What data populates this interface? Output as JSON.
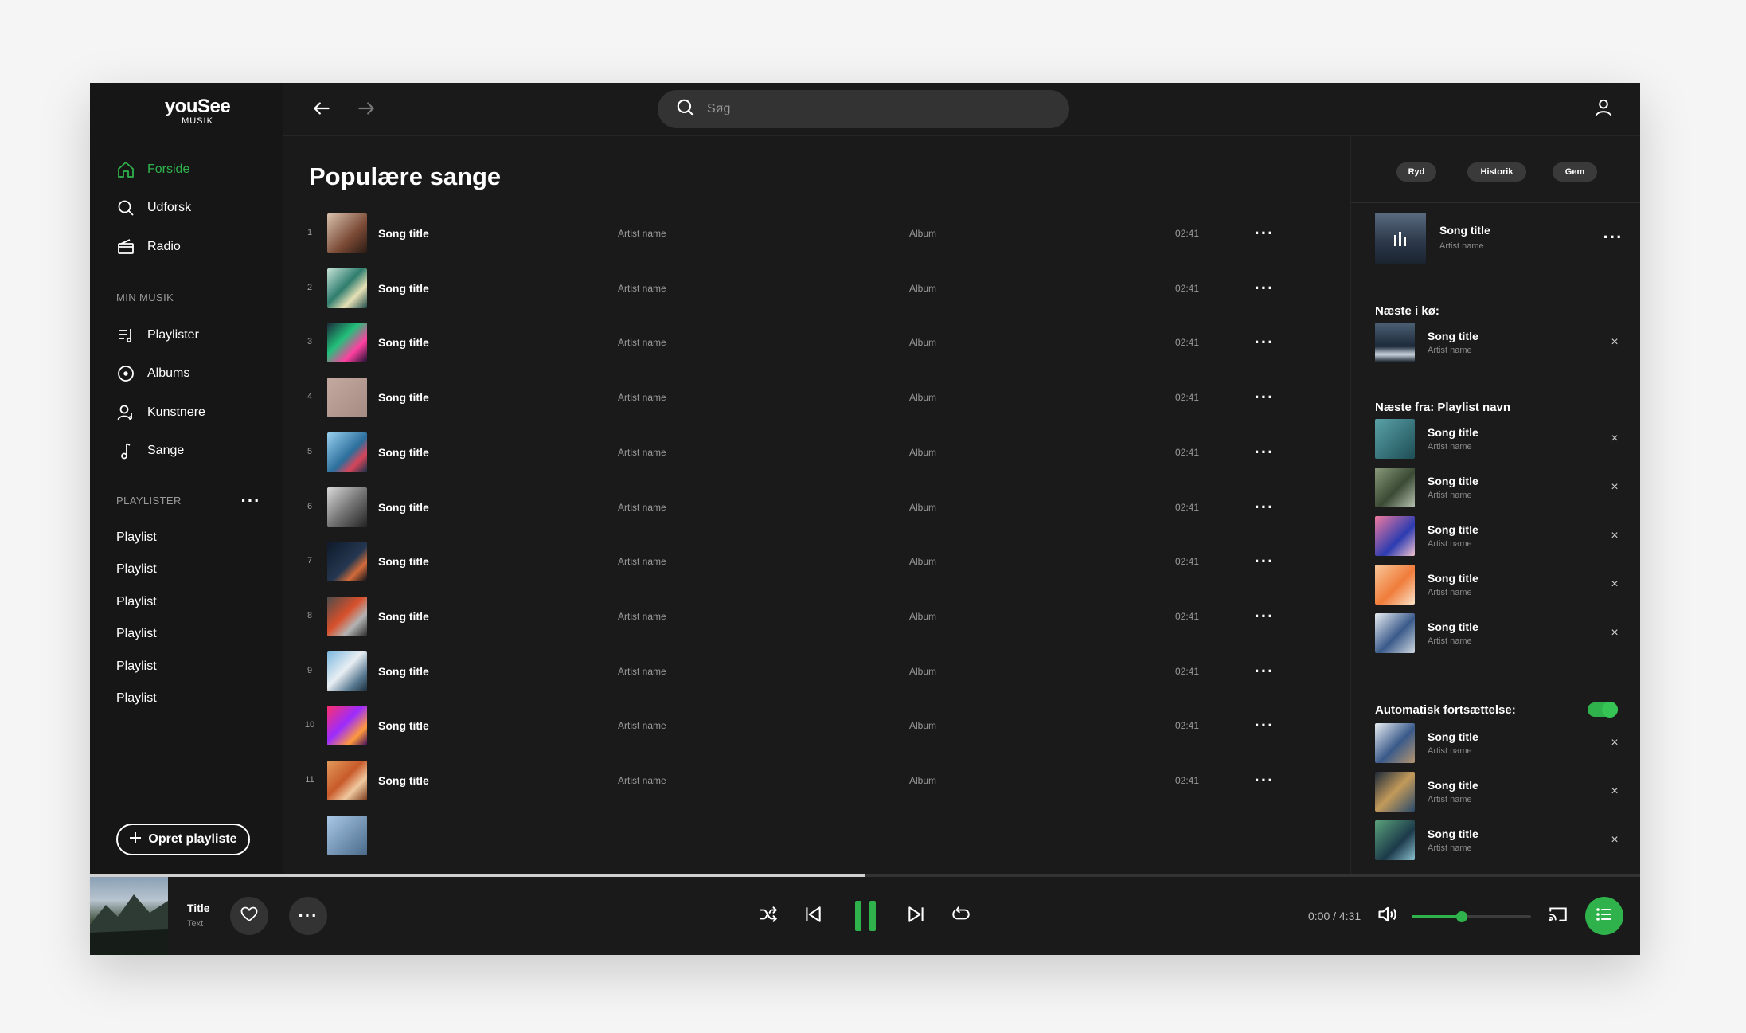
{
  "app": {
    "logo_main": "youSee",
    "logo_sub": "MUSIK"
  },
  "sidebar": {
    "nav": [
      {
        "label": "Forside",
        "icon": "home-icon",
        "active": true
      },
      {
        "label": "Udforsk",
        "icon": "search-icon",
        "active": false
      },
      {
        "label": "Radio",
        "icon": "radio-icon",
        "active": false
      }
    ],
    "my_music_label": "MIN MUSIK",
    "my_music": [
      {
        "label": "Playlister",
        "icon": "playlist-icon"
      },
      {
        "label": "Albums",
        "icon": "album-icon"
      },
      {
        "label": "Kunstnere",
        "icon": "artist-icon"
      },
      {
        "label": "Sange",
        "icon": "note-icon"
      }
    ],
    "playlists_label": "PLAYLISTER",
    "playlists": [
      "Playlist",
      "Playlist",
      "Playlist",
      "Playlist",
      "Playlist",
      "Playlist"
    ],
    "create_label": "Opret playliste"
  },
  "topbar": {
    "search_placeholder": "Søg"
  },
  "main": {
    "title": "Populære sange",
    "tracks": [
      {
        "num": "1",
        "title": "Song title",
        "artist": "Artist name",
        "album": "Album",
        "duration": "02:41"
      },
      {
        "num": "2",
        "title": "Song title",
        "artist": "Artist name",
        "album": "Album",
        "duration": "02:41"
      },
      {
        "num": "3",
        "title": "Song title",
        "artist": "Artist name",
        "album": "Album",
        "duration": "02:41"
      },
      {
        "num": "4",
        "title": "Song title",
        "artist": "Artist name",
        "album": "Album",
        "duration": "02:41"
      },
      {
        "num": "5",
        "title": "Song title",
        "artist": "Artist name",
        "album": "Album",
        "duration": "02:41"
      },
      {
        "num": "6",
        "title": "Song title",
        "artist": "Artist name",
        "album": "Album",
        "duration": "02:41"
      },
      {
        "num": "7",
        "title": "Song title",
        "artist": "Artist name",
        "album": "Album",
        "duration": "02:41"
      },
      {
        "num": "8",
        "title": "Song title",
        "artist": "Artist name",
        "album": "Album",
        "duration": "02:41"
      },
      {
        "num": "9",
        "title": "Song title",
        "artist": "Artist name",
        "album": "Album",
        "duration": "02:41"
      },
      {
        "num": "10",
        "title": "Song title",
        "artist": "Artist name",
        "album": "Album",
        "duration": "02:41"
      },
      {
        "num": "11",
        "title": "Song title",
        "artist": "Artist name",
        "album": "Album",
        "duration": "02:41"
      }
    ]
  },
  "queue": {
    "pills": [
      "Ryd",
      "Historik",
      "Gem"
    ],
    "now_playing": {
      "title": "Song title",
      "artist": "Artist name"
    },
    "next_label": "Næste i kø:",
    "next": [
      {
        "title": "Song title",
        "artist": "Artist name"
      }
    ],
    "from_label": "Næste fra: Playlist navn",
    "from": [
      {
        "title": "Song title",
        "artist": "Artist name"
      },
      {
        "title": "Song title",
        "artist": "Artist name"
      },
      {
        "title": "Song title",
        "artist": "Artist name"
      },
      {
        "title": "Song title",
        "artist": "Artist name"
      },
      {
        "title": "Song title",
        "artist": "Artist name"
      }
    ],
    "autoplay_label": "Automatisk fortsættelse:",
    "autoplay_on": true,
    "autoplay": [
      {
        "title": "Song title",
        "artist": "Artist name"
      },
      {
        "title": "Song title",
        "artist": "Artist name"
      },
      {
        "title": "Song title",
        "artist": "Artist name"
      }
    ],
    "close_glyph": "×"
  },
  "player": {
    "title": "Title",
    "subtitle": "Text",
    "time": "0:00 / 4:31",
    "track_progress_fraction": 0.5,
    "volume_fraction": 0.42
  },
  "colors": {
    "accent": "#2fb24c",
    "background": "#1a1a1a"
  }
}
